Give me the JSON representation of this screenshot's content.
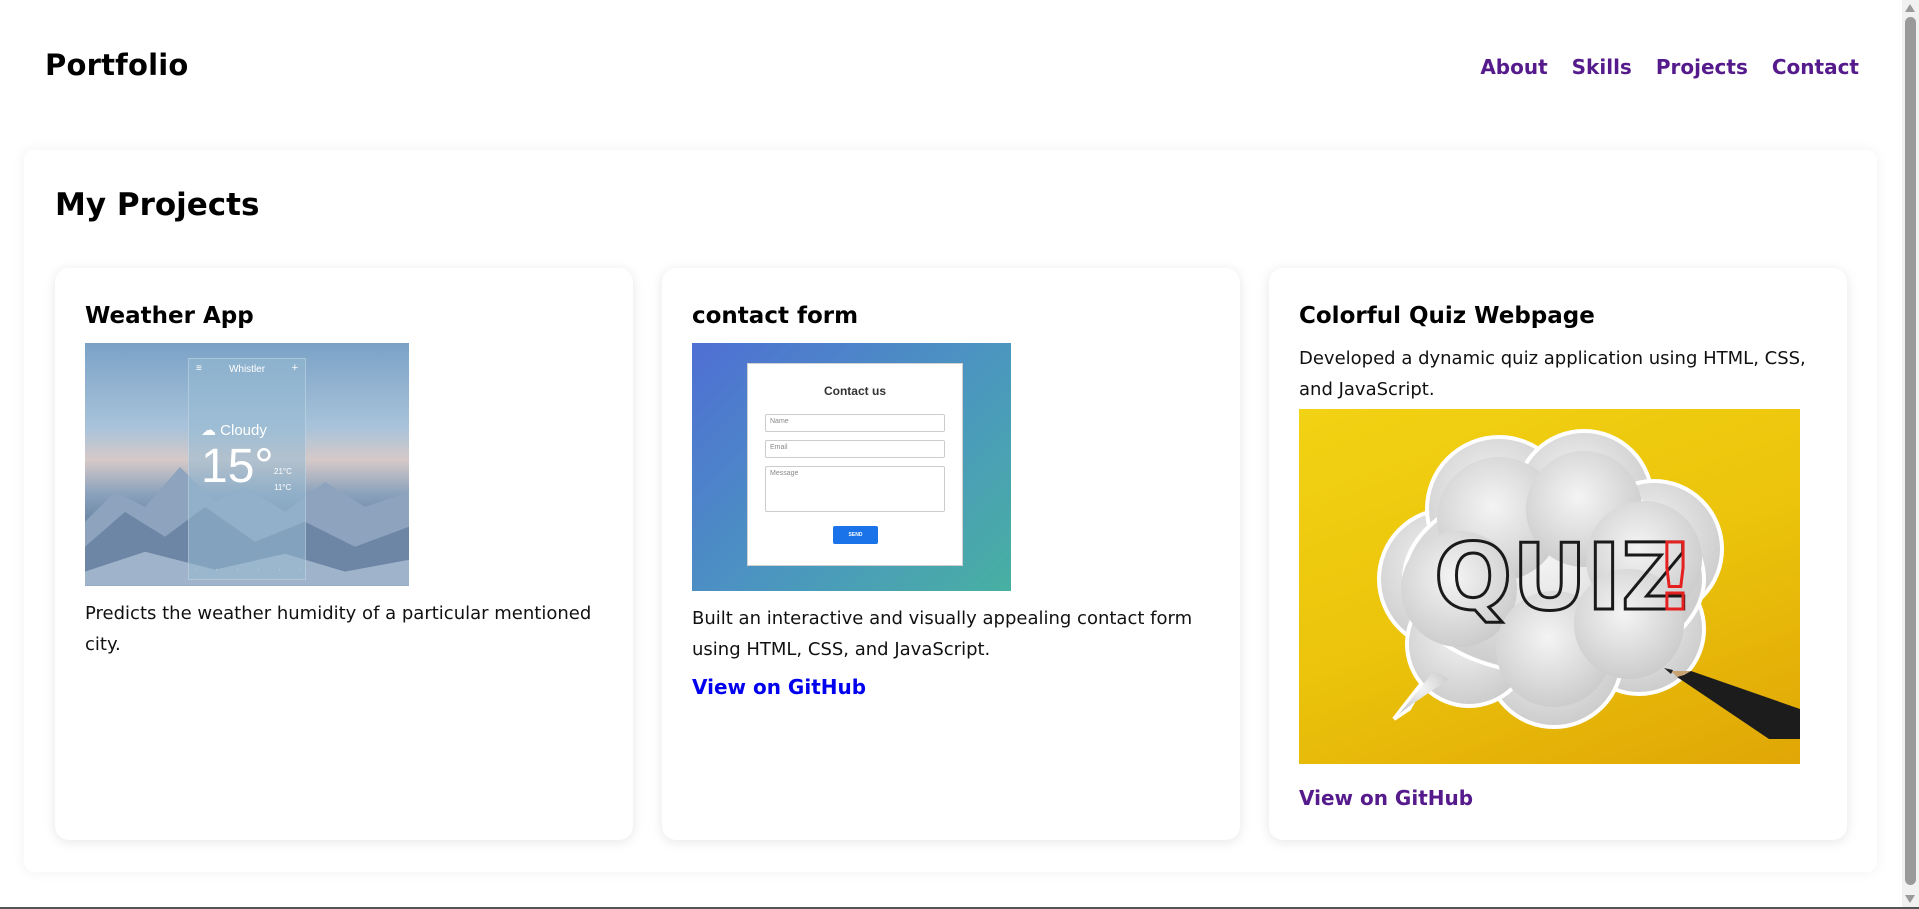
{
  "header": {
    "logo": "Portfolio",
    "nav": [
      "About",
      "Skills",
      "Projects",
      "Contact"
    ]
  },
  "projects": {
    "title": "My Projects",
    "cards": [
      {
        "title": "Weather App",
        "description": "Predicts the weather humidity of a particular mentioned city.",
        "image": {
          "city": "Whistler",
          "menu_icon": "≡",
          "add_icon": "+",
          "condition": "Cloudy",
          "temperature": "15°",
          "high": "21°C",
          "low": "11°C"
        }
      },
      {
        "title": "contact form",
        "description": "Built an interactive and visually appealing contact form using HTML, CSS, and JavaScript.",
        "link": "View on GitHub",
        "image": {
          "heading": "Contact us",
          "name_placeholder": "Name",
          "email_placeholder": "Email",
          "message_placeholder": "Message",
          "button": "SEND"
        }
      },
      {
        "title": "Colorful Quiz Webpage",
        "description": "Developed a dynamic quiz application using HTML, CSS, and JavaScript.",
        "link": "View on GitHub",
        "image": {
          "text": "QUIZ",
          "mark": "!"
        }
      }
    ]
  },
  "colors": {
    "nav_link": "#551a8b",
    "link_unvisited": "#0000ee",
    "link_visited": "#551a8b",
    "quiz_background": "#ebc40b",
    "contact_gradient_start": "#4f6fd4",
    "contact_gradient_end": "#48b0a2"
  }
}
